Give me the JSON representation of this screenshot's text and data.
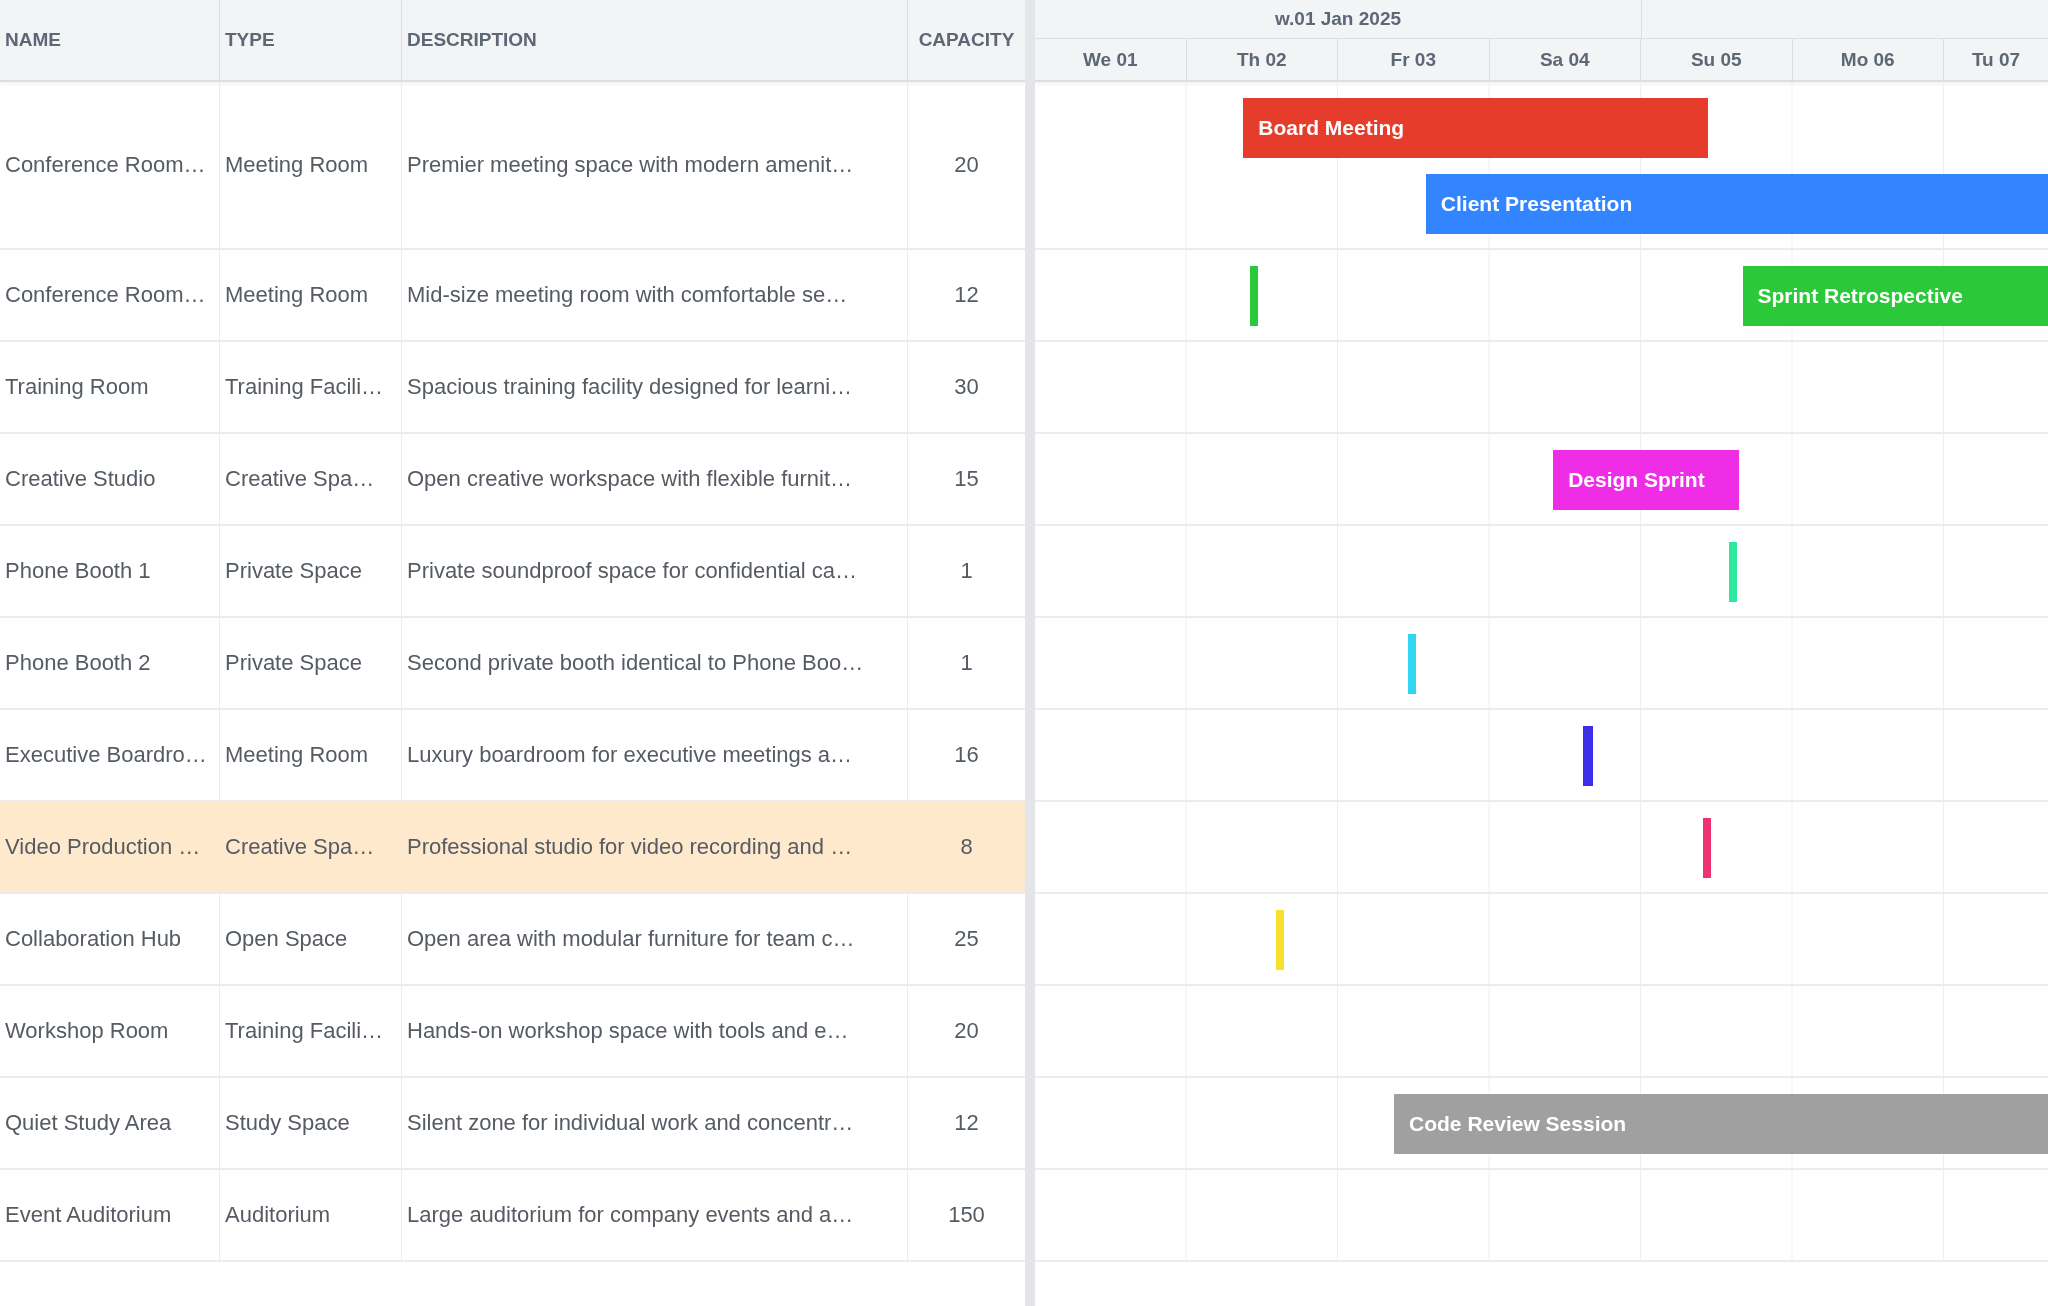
{
  "columns": [
    "NAME",
    "TYPE",
    "DESCRIPTION",
    "CAPACITY"
  ],
  "timeline": {
    "week": "w.01 Jan 2025",
    "days": [
      "We 01",
      "Th 02",
      "Fr 03",
      "Sa 04",
      "Su 05",
      "Mo 06",
      "Tu 07"
    ]
  },
  "rows": [
    {
      "name": "Conference Room…",
      "type": "Meeting Room",
      "description": "Premier meeting space with modern amenit…",
      "capacity": "20",
      "selected": false,
      "events": [
        {
          "title": "Board Meeting",
          "color": "#e63c2b"
        },
        {
          "title": "Client Presentation",
          "color": "#3385ff"
        }
      ]
    },
    {
      "name": "Conference Room…",
      "type": "Meeting Room",
      "description": "Mid-size meeting room with comfortable se…",
      "capacity": "12",
      "selected": false,
      "events": [
        {
          "color": "#2bc93a"
        },
        {
          "title": "Sprint Retrospective",
          "color": "#2bc93a"
        }
      ]
    },
    {
      "name": "Training Room",
      "type": "Training Facili…",
      "description": "Spacious training facility designed for learni…",
      "capacity": "30",
      "selected": false,
      "events": []
    },
    {
      "name": "Creative Studio",
      "type": "Creative Spa…",
      "description": "Open creative workspace with flexible furnit…",
      "capacity": "15",
      "selected": false,
      "events": [
        {
          "title": "Design Sprint",
          "color": "#f02de6"
        }
      ]
    },
    {
      "name": "Phone Booth 1",
      "type": "Private Space",
      "description": "Private soundproof space for confidential ca…",
      "capacity": "1",
      "selected": false,
      "events": [
        {
          "color": "#2ee8a0"
        }
      ]
    },
    {
      "name": "Phone Booth 2",
      "type": "Private Space",
      "description": "Second private booth identical to Phone Boo…",
      "capacity": "1",
      "selected": false,
      "events": [
        {
          "color": "#33d6f0"
        }
      ]
    },
    {
      "name": "Executive Boardro…",
      "type": "Meeting Room",
      "description": "Luxury boardroom for executive meetings a…",
      "capacity": "16",
      "selected": false,
      "events": [
        {
          "color": "#3d2ee8"
        }
      ]
    },
    {
      "name": "Video Production …",
      "type": "Creative Spa…",
      "description": "Professional studio for video recording and …",
      "capacity": "8",
      "selected": true,
      "events": [
        {
          "color": "#f03275"
        }
      ]
    },
    {
      "name": "Collaboration Hub",
      "type": "Open Space",
      "description": "Open area with modular furniture for team c…",
      "capacity": "25",
      "selected": false,
      "events": [
        {
          "color": "#f5e12e"
        }
      ]
    },
    {
      "name": "Workshop Room",
      "type": "Training Facili…",
      "description": "Hands-on workshop space with tools and e…",
      "capacity": "20",
      "selected": false,
      "events": []
    },
    {
      "name": "Quiet Study Area",
      "type": "Study Space",
      "description": "Silent zone for individual work and concentr…",
      "capacity": "12",
      "selected": false,
      "events": [
        {
          "title": "Code Review Session",
          "color": "#a0a0a0"
        }
      ]
    },
    {
      "name": "Event Auditorium",
      "type": "Auditorium",
      "description": "Large auditorium for company events and a…",
      "capacity": "150",
      "selected": false,
      "events": []
    }
  ]
}
